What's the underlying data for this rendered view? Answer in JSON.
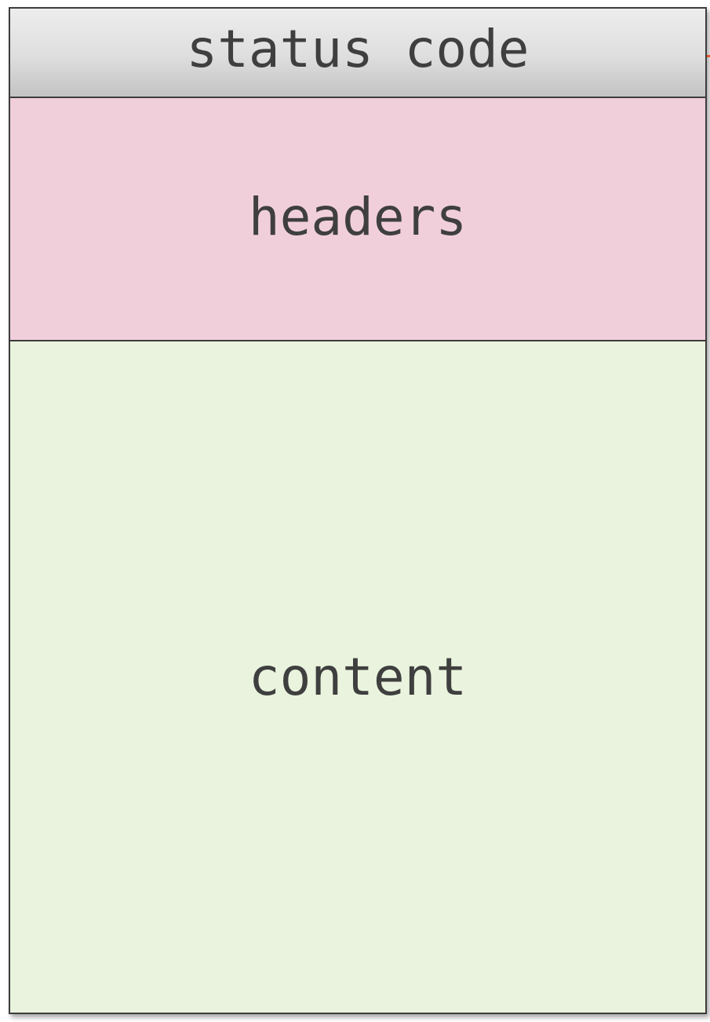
{
  "sections": {
    "status": {
      "label": "status code",
      "color": "#dedede"
    },
    "headers": {
      "label": "headers",
      "color": "#f0cfdb"
    },
    "content": {
      "label": "content",
      "color": "#e9f3dd"
    }
  },
  "colors": {
    "border": "#3c3c3c",
    "text": "#3f3f3f",
    "marker": "#e05a2a"
  }
}
